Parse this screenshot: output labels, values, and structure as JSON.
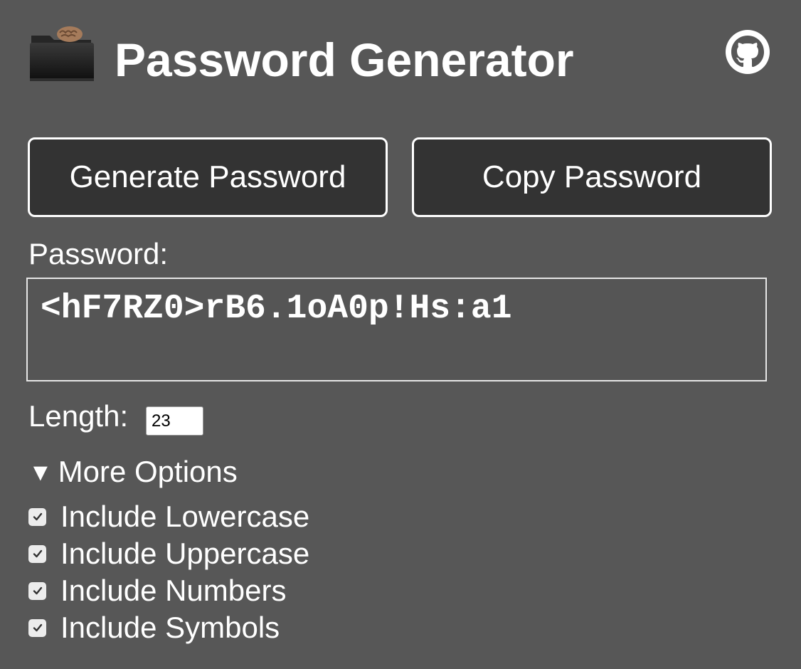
{
  "header": {
    "title": "Password Generator",
    "app_icon": "folder-with-brain-icon",
    "github_icon": "github-icon"
  },
  "buttons": {
    "generate_label": "Generate Password",
    "copy_label": "Copy Password"
  },
  "password": {
    "label": "Password:",
    "value": "<hF7RZ0>rB6.1oA0p!Hs:a1"
  },
  "length": {
    "label": "Length:",
    "value": "23"
  },
  "options": {
    "toggle_label": "More Options",
    "expanded": true,
    "items": [
      {
        "label": "Include Lowercase",
        "checked": true
      },
      {
        "label": "Include Uppercase",
        "checked": true
      },
      {
        "label": "Include Numbers",
        "checked": true
      },
      {
        "label": "Include Symbols",
        "checked": true
      }
    ]
  },
  "colors": {
    "background": "#575757",
    "button_fill": "#333333",
    "text": "#ffffff"
  }
}
